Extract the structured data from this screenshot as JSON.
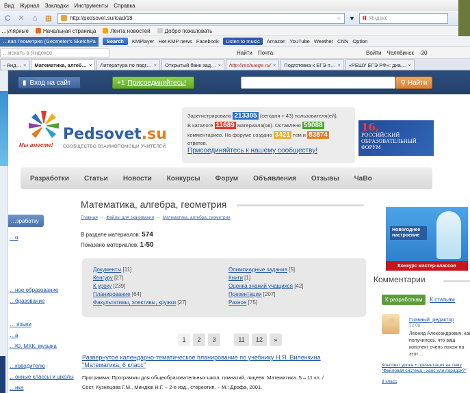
{
  "browser": {
    "menu": [
      "Вид",
      "Журнал",
      "Закладки",
      "Инструменты",
      "Справка"
    ],
    "url": "http://pedsovet.su/load/18",
    "search_placeholder": "Яндекс",
    "bookmarks": [
      "…улярные",
      "Начальная страница",
      "Лента новостей",
      "Добро пожаловать"
    ],
    "toolbar": {
      "geom": "…вая Геометрия (Geometer's SketchPa",
      "search": "Search",
      "items": [
        "KMPlayer",
        "Hot KMP news",
        "Facebook",
        "Listen to music",
        "Amazon",
        "YouTube",
        "Weather",
        "CNN",
        "Option"
      ]
    },
    "yandex": {
      "placeholder": "…искать в Яндексе",
      "items": [
        "Найти",
        "Почта",
        "Войти",
        "Челябинск",
        "-20"
      ]
    },
    "tabs": [
      {
        "label": "- Янд…",
        "active": false
      },
      {
        "label": "Математика, алгеб…",
        "active": true
      },
      {
        "label": "Литература по подг…",
        "active": false
      },
      {
        "label": "Открытый банк зад…",
        "active": false
      },
      {
        "label": "http://reshuege.ru/",
        "active": false
      },
      {
        "label": "Подготовка к ЕГЭ п…",
        "active": false
      },
      {
        "label": "«РЕШУ ЕГЭ РФ»: диа…",
        "active": false
      }
    ]
  },
  "site": {
    "login": "Вход на сайт",
    "join": "Присоединяйтесь!",
    "join_prefix": "+1",
    "find": "Найти",
    "logo_main": "Pedsovet",
    "logo_tld": ".su",
    "logo_slogan": "Мы вместе!",
    "logo_sub": "СООБЩЕСТВО ВЗАИМОПОМОЩИ УЧИТЕЛЕЙ",
    "stats": {
      "reg_prefix": "Зарегистрировано",
      "reg_num": "213305",
      "reg_suffix": "(сегодня + 43) пользователя(ей),",
      "cat_prefix": "В каталоге",
      "cat_num": "11689",
      "cat_mid": "материала(ов). Оставлено",
      "cat_num2": "59088",
      "forum_prefix": "комментариев. На форуме создано",
      "forum_num": "3421",
      "forum_mid": "тем и",
      "forum_num2": "83874",
      "forum_suffix": "ответов.",
      "join_link": "Присоединяйтесь к нашему сообществу!"
    },
    "banner": {
      "big": "16,",
      "line1": "РОССИЙСКИЙ",
      "line2": "ОБРАЗОВАТЕЛЬНЫЙ",
      "line3": "ФОРУМ"
    },
    "nav": [
      "Разработки",
      "Статьи",
      "Новости",
      "Конкурсы",
      "Форум",
      "Объявления",
      "Отзывы",
      "ЧаВо"
    ]
  },
  "content": {
    "title": "Математика, алгебра, геометрия",
    "breadcrumbs": [
      "Главная",
      "Файлы для скачивания",
      "Математика, алгебра, геометрия"
    ],
    "in_section_label": "В разделе материалов:",
    "in_section_value": "574",
    "shown_label": "Показано материалов:",
    "shown_value": "1-50",
    "categories_left": [
      {
        "name": "Документы",
        "count": "[11]"
      },
      {
        "name": "Кенгуру",
        "count": "[27]"
      },
      {
        "name": "К уроку",
        "count": "[239]"
      },
      {
        "name": "Планирование",
        "count": "[64]"
      },
      {
        "name": "Факультативы, элективы, кружки",
        "count": "[27]"
      }
    ],
    "categories_right": [
      {
        "name": "Олимпиадные задания",
        "count": "[5]"
      },
      {
        "name": "Книги",
        "count": "[1]"
      },
      {
        "name": "Оценка знаний учащихся",
        "count": "[42]"
      },
      {
        "name": "Презентации",
        "count": "[207]"
      },
      {
        "name": "Разное",
        "count": "[75]"
      }
    ],
    "pages": [
      "1",
      "2",
      "3",
      "11",
      "12",
      "»"
    ],
    "article_title": "Развернутое календарно-тематическое планирование по учебнику Н.Я. Виленкина \"Математика, 6 класс\"",
    "article_desc1": "Программа: Программы для общеобразовательных школ, гимназий, лицеев: Математика. 5 – 11 кл. /",
    "article_desc2": "Сост. Кузнецова Г.М., Миндюк Н.Г. – 2-е изд., стереотип. – М.: Дрофа, 2001."
  },
  "left_sidebar": {
    "button": "…зработку",
    "links": [
      "…о",
      "…ное образование",
      "…бразование",
      "… языки",
      "…а",
      "…Ю, МХК, музыка",
      "…ководителю",
      "…онные классы и школы",
      "…ика"
    ]
  },
  "right_sidebar": {
    "promo_top": "Новогоднее настроение",
    "promo_bottom": "Конкурс мастер-классов",
    "comments_title": "Комментарии",
    "tab_active": "К разработкам",
    "tab_other": "К статьям",
    "author": "Главный_редактор",
    "time": "22:08",
    "text": "Леонид Александрович, как получилось, что ваш конспект очень похож на этот…",
    "link": "Конспект урока + презентация на тему \"Файловая система - хаос или порядок?\"",
    "new": "8 класс"
  },
  "colors": {
    "site_bar": "#2c4d7c",
    "join_green": "#5ea82c",
    "find_orange": "#d6823a",
    "link": "#1a55a8"
  }
}
